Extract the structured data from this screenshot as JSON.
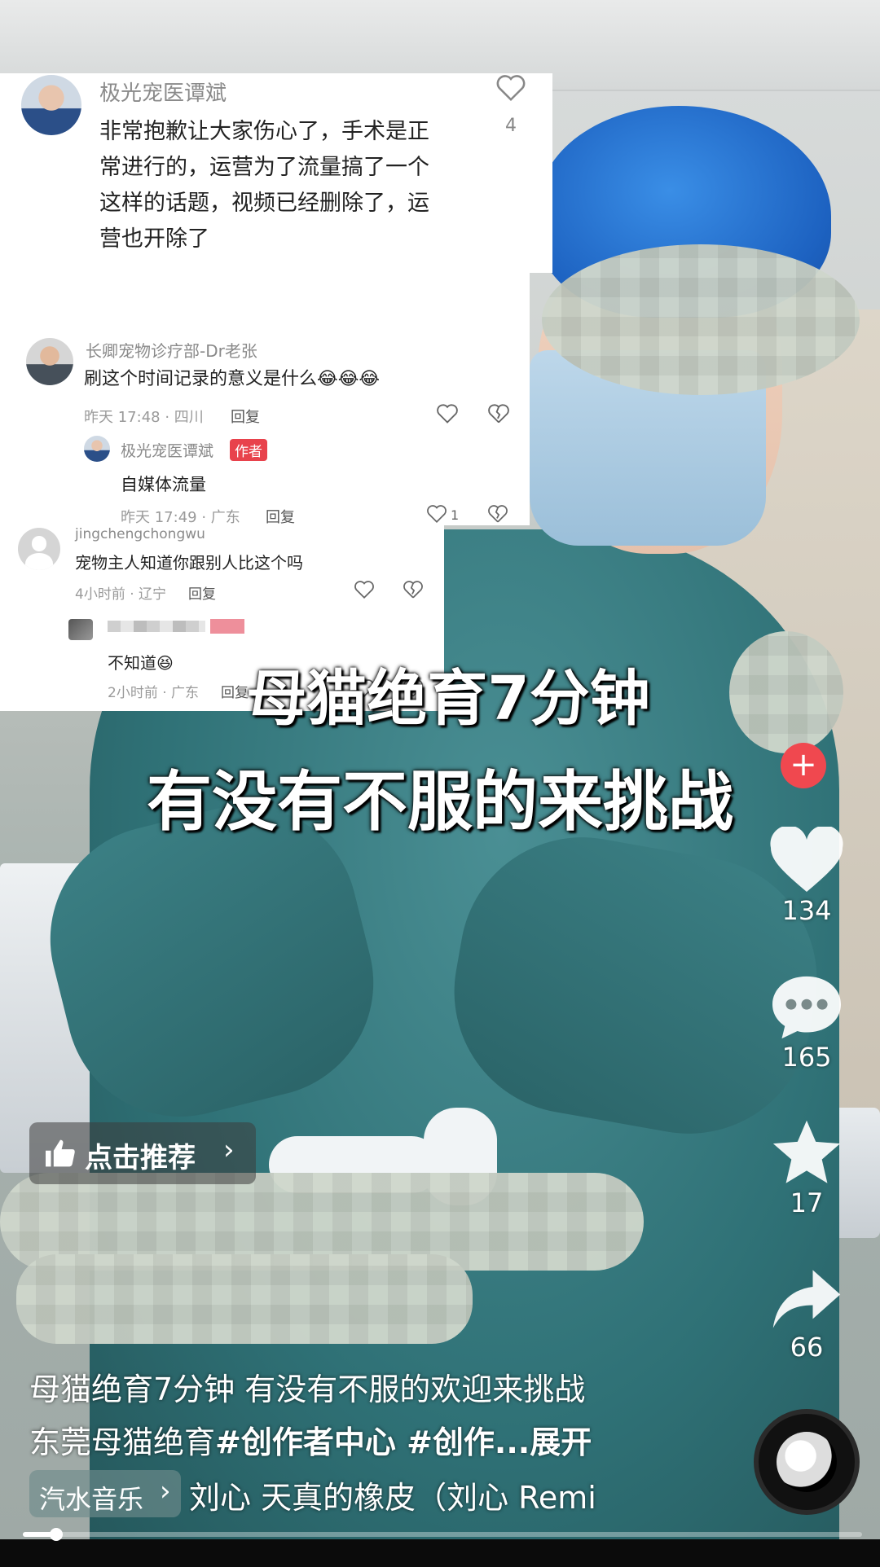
{
  "comments": {
    "top": {
      "author": "极光宠医谭斌",
      "lines": [
        "非常抱歉让大家伤心了，手术是正",
        "常进行的，运营为了流量搞了一个",
        "这样的话题，视频已经删除了，运",
        "营也开除了"
      ],
      "likes": "4"
    },
    "second": {
      "author": "长卿宠物诊疗部-Dr老张",
      "text": "刷这个时间记录的意义是什么",
      "meta": "昨天 17:48 · 四川",
      "reply_label": "回复",
      "reply": {
        "author": "极光宠医谭斌",
        "badge": "作者",
        "text": "自媒体流量",
        "meta": "昨天 17:49 · 广东",
        "reply_label": "回复",
        "likes": "1"
      }
    },
    "third": {
      "author": "jingchengchongwu",
      "text": "宠物主人知道你跟别人比这个吗",
      "meta": "4小时前 · 辽宁",
      "reply_label": "回复",
      "reply": {
        "text": "不知道",
        "meta": "2小时前 · 广东",
        "reply_label": "回复"
      }
    }
  },
  "overlay": {
    "line1": "母猫绝育7分钟",
    "line2": "有没有不服的来挑战"
  },
  "rail": {
    "likes": "134",
    "comments": "165",
    "favorites": "17",
    "shares": "66"
  },
  "recommend_chip": "点击推荐",
  "description": {
    "line1": "母猫绝育7分钟 有没有不服的欢迎来挑战",
    "line2_plain": "东莞母猫绝育",
    "line2_tags": "#创作者中心 #创作...",
    "expand": "展开"
  },
  "music": {
    "chip": "汽水音乐",
    "track": "刘心  天真的橡皮（刘心 Remi"
  },
  "playback_progress": 0.04,
  "colors": {
    "author_badge": "#e8424c",
    "like_white": "#ffffff"
  }
}
